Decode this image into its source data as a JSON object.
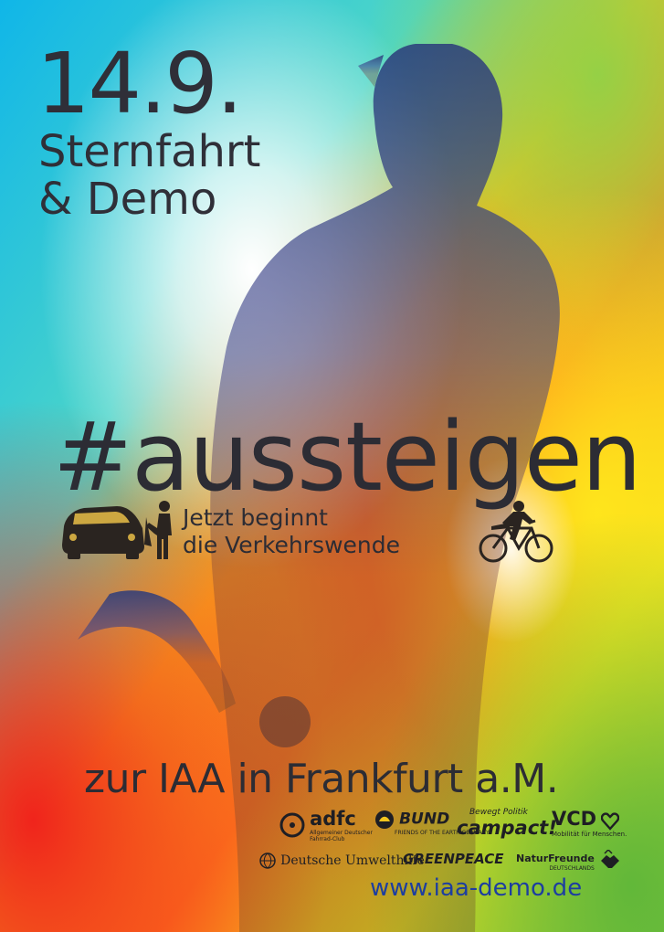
{
  "headline": {
    "date": "14.9.",
    "line1": "Sternfahrt",
    "line2": "& Demo"
  },
  "hashtag": "#aussteigen",
  "tagline": {
    "line1": "Jetzt beginnt",
    "line2": "die Verkehrswende"
  },
  "destination": "zur IAA in Frankfurt a.M.",
  "url": "www.iaa-demo.de",
  "logos": {
    "adfc": {
      "name": "adfc",
      "sub1": "Allgemeiner Deutscher",
      "sub2": "Fahrrad-Club"
    },
    "bund": {
      "name": "BUND",
      "sub": "FRIENDS OF THE EARTH GERMANY"
    },
    "campact": {
      "name": "campact!",
      "slogan": "Bewegt Politik"
    },
    "vcd": {
      "name": "VCD",
      "sub": "Mobilität für Menschen."
    },
    "duh": {
      "name": "Deutsche Umwelthilfe"
    },
    "greenpeace": {
      "name": "GREENPEACE"
    },
    "naturfreunde": {
      "name": "NaturFreunde",
      "sub": "DEUTSCHLANDS"
    }
  },
  "colors": {
    "text_dark": "#2c2c34",
    "url_blue": "#1d3ea0",
    "cyan": "#1fb8e6",
    "yellow": "#f6e21e",
    "orange": "#ff7a1c",
    "red": "#e82c22",
    "green": "#7cc33a"
  }
}
